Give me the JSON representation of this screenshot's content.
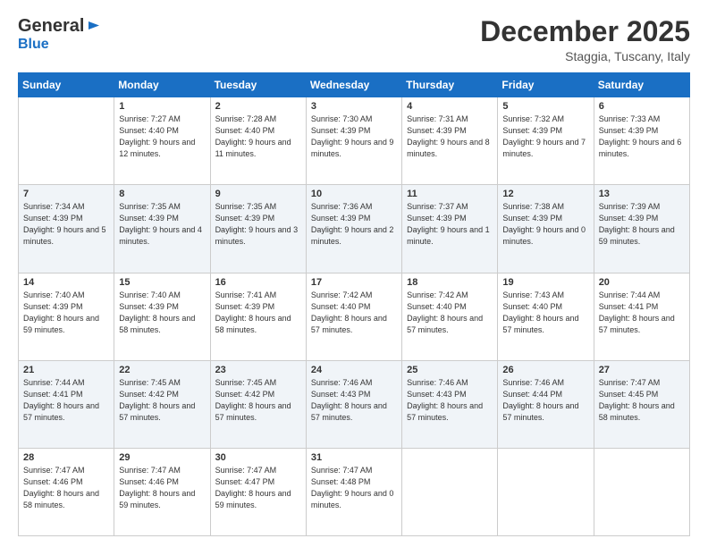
{
  "header": {
    "logo": {
      "general": "General",
      "blue": "Blue"
    },
    "title": "December 2025",
    "location": "Staggia, Tuscany, Italy"
  },
  "calendar": {
    "days_of_week": [
      "Sunday",
      "Monday",
      "Tuesday",
      "Wednesday",
      "Thursday",
      "Friday",
      "Saturday"
    ],
    "weeks": [
      [
        {
          "day": "",
          "sunrise": "",
          "sunset": "",
          "daylight": ""
        },
        {
          "day": "1",
          "sunrise": "Sunrise: 7:27 AM",
          "sunset": "Sunset: 4:40 PM",
          "daylight": "Daylight: 9 hours and 12 minutes."
        },
        {
          "day": "2",
          "sunrise": "Sunrise: 7:28 AM",
          "sunset": "Sunset: 4:40 PM",
          "daylight": "Daylight: 9 hours and 11 minutes."
        },
        {
          "day": "3",
          "sunrise": "Sunrise: 7:30 AM",
          "sunset": "Sunset: 4:39 PM",
          "daylight": "Daylight: 9 hours and 9 minutes."
        },
        {
          "day": "4",
          "sunrise": "Sunrise: 7:31 AM",
          "sunset": "Sunset: 4:39 PM",
          "daylight": "Daylight: 9 hours and 8 minutes."
        },
        {
          "day": "5",
          "sunrise": "Sunrise: 7:32 AM",
          "sunset": "Sunset: 4:39 PM",
          "daylight": "Daylight: 9 hours and 7 minutes."
        },
        {
          "day": "6",
          "sunrise": "Sunrise: 7:33 AM",
          "sunset": "Sunset: 4:39 PM",
          "daylight": "Daylight: 9 hours and 6 minutes."
        }
      ],
      [
        {
          "day": "7",
          "sunrise": "Sunrise: 7:34 AM",
          "sunset": "Sunset: 4:39 PM",
          "daylight": "Daylight: 9 hours and 5 minutes."
        },
        {
          "day": "8",
          "sunrise": "Sunrise: 7:35 AM",
          "sunset": "Sunset: 4:39 PM",
          "daylight": "Daylight: 9 hours and 4 minutes."
        },
        {
          "day": "9",
          "sunrise": "Sunrise: 7:35 AM",
          "sunset": "Sunset: 4:39 PM",
          "daylight": "Daylight: 9 hours and 3 minutes."
        },
        {
          "day": "10",
          "sunrise": "Sunrise: 7:36 AM",
          "sunset": "Sunset: 4:39 PM",
          "daylight": "Daylight: 9 hours and 2 minutes."
        },
        {
          "day": "11",
          "sunrise": "Sunrise: 7:37 AM",
          "sunset": "Sunset: 4:39 PM",
          "daylight": "Daylight: 9 hours and 1 minute."
        },
        {
          "day": "12",
          "sunrise": "Sunrise: 7:38 AM",
          "sunset": "Sunset: 4:39 PM",
          "daylight": "Daylight: 9 hours and 0 minutes."
        },
        {
          "day": "13",
          "sunrise": "Sunrise: 7:39 AM",
          "sunset": "Sunset: 4:39 PM",
          "daylight": "Daylight: 8 hours and 59 minutes."
        }
      ],
      [
        {
          "day": "14",
          "sunrise": "Sunrise: 7:40 AM",
          "sunset": "Sunset: 4:39 PM",
          "daylight": "Daylight: 8 hours and 59 minutes."
        },
        {
          "day": "15",
          "sunrise": "Sunrise: 7:40 AM",
          "sunset": "Sunset: 4:39 PM",
          "daylight": "Daylight: 8 hours and 58 minutes."
        },
        {
          "day": "16",
          "sunrise": "Sunrise: 7:41 AM",
          "sunset": "Sunset: 4:39 PM",
          "daylight": "Daylight: 8 hours and 58 minutes."
        },
        {
          "day": "17",
          "sunrise": "Sunrise: 7:42 AM",
          "sunset": "Sunset: 4:40 PM",
          "daylight": "Daylight: 8 hours and 57 minutes."
        },
        {
          "day": "18",
          "sunrise": "Sunrise: 7:42 AM",
          "sunset": "Sunset: 4:40 PM",
          "daylight": "Daylight: 8 hours and 57 minutes."
        },
        {
          "day": "19",
          "sunrise": "Sunrise: 7:43 AM",
          "sunset": "Sunset: 4:40 PM",
          "daylight": "Daylight: 8 hours and 57 minutes."
        },
        {
          "day": "20",
          "sunrise": "Sunrise: 7:44 AM",
          "sunset": "Sunset: 4:41 PM",
          "daylight": "Daylight: 8 hours and 57 minutes."
        }
      ],
      [
        {
          "day": "21",
          "sunrise": "Sunrise: 7:44 AM",
          "sunset": "Sunset: 4:41 PM",
          "daylight": "Daylight: 8 hours and 57 minutes."
        },
        {
          "day": "22",
          "sunrise": "Sunrise: 7:45 AM",
          "sunset": "Sunset: 4:42 PM",
          "daylight": "Daylight: 8 hours and 57 minutes."
        },
        {
          "day": "23",
          "sunrise": "Sunrise: 7:45 AM",
          "sunset": "Sunset: 4:42 PM",
          "daylight": "Daylight: 8 hours and 57 minutes."
        },
        {
          "day": "24",
          "sunrise": "Sunrise: 7:46 AM",
          "sunset": "Sunset: 4:43 PM",
          "daylight": "Daylight: 8 hours and 57 minutes."
        },
        {
          "day": "25",
          "sunrise": "Sunrise: 7:46 AM",
          "sunset": "Sunset: 4:43 PM",
          "daylight": "Daylight: 8 hours and 57 minutes."
        },
        {
          "day": "26",
          "sunrise": "Sunrise: 7:46 AM",
          "sunset": "Sunset: 4:44 PM",
          "daylight": "Daylight: 8 hours and 57 minutes."
        },
        {
          "day": "27",
          "sunrise": "Sunrise: 7:47 AM",
          "sunset": "Sunset: 4:45 PM",
          "daylight": "Daylight: 8 hours and 58 minutes."
        }
      ],
      [
        {
          "day": "28",
          "sunrise": "Sunrise: 7:47 AM",
          "sunset": "Sunset: 4:46 PM",
          "daylight": "Daylight: 8 hours and 58 minutes."
        },
        {
          "day": "29",
          "sunrise": "Sunrise: 7:47 AM",
          "sunset": "Sunset: 4:46 PM",
          "daylight": "Daylight: 8 hours and 59 minutes."
        },
        {
          "day": "30",
          "sunrise": "Sunrise: 7:47 AM",
          "sunset": "Sunset: 4:47 PM",
          "daylight": "Daylight: 8 hours and 59 minutes."
        },
        {
          "day": "31",
          "sunrise": "Sunrise: 7:47 AM",
          "sunset": "Sunset: 4:48 PM",
          "daylight": "Daylight: 9 hours and 0 minutes."
        },
        {
          "day": "",
          "sunrise": "",
          "sunset": "",
          "daylight": ""
        },
        {
          "day": "",
          "sunrise": "",
          "sunset": "",
          "daylight": ""
        },
        {
          "day": "",
          "sunrise": "",
          "sunset": "",
          "daylight": ""
        }
      ]
    ]
  }
}
